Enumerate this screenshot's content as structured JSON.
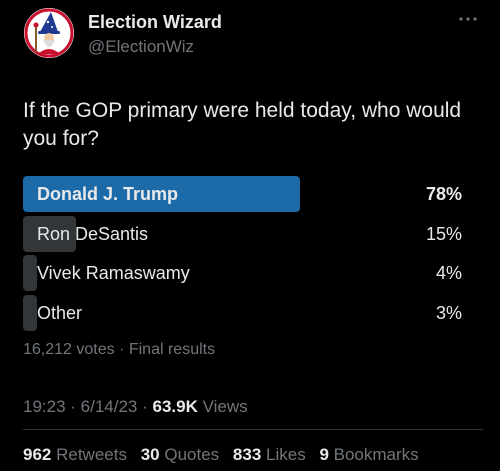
{
  "author": {
    "display_name": "Election Wizard",
    "handle": "@ElectionWiz",
    "avatar_icon": "wizard-icon"
  },
  "tweet": {
    "text": "If the GOP primary were held today, who would you for?"
  },
  "poll": {
    "options": [
      {
        "label": "Donald J. Trump",
        "percent_label": "78%",
        "percent": 78,
        "winner": true
      },
      {
        "label": "Ron DeSantis",
        "percent_label": "15%",
        "percent": 15,
        "winner": false
      },
      {
        "label": "Vivek Ramaswamy",
        "percent_label": "4%",
        "percent": 4,
        "winner": false
      },
      {
        "label": "Other",
        "percent_label": "3%",
        "percent": 3,
        "winner": false
      }
    ],
    "meta": "16,212 votes · Final results"
  },
  "timestamp": {
    "text": "19:23 · 6/14/23 · ",
    "views_count": "63.9K",
    "views_label": " Views"
  },
  "stats": {
    "retweets_count": "962",
    "retweets_label": " Retweets",
    "quotes_count": "30",
    "quotes_label": " Quotes",
    "likes_count": "833",
    "likes_label": " Likes",
    "bookmarks_count": "9",
    "bookmarks_label": " Bookmarks"
  },
  "colors": {
    "background": "#000000",
    "winner_bar": "#1d6aa8",
    "loser_bar": "#333639",
    "muted_text": "#71767b",
    "primary_text": "#e7e9ea"
  }
}
